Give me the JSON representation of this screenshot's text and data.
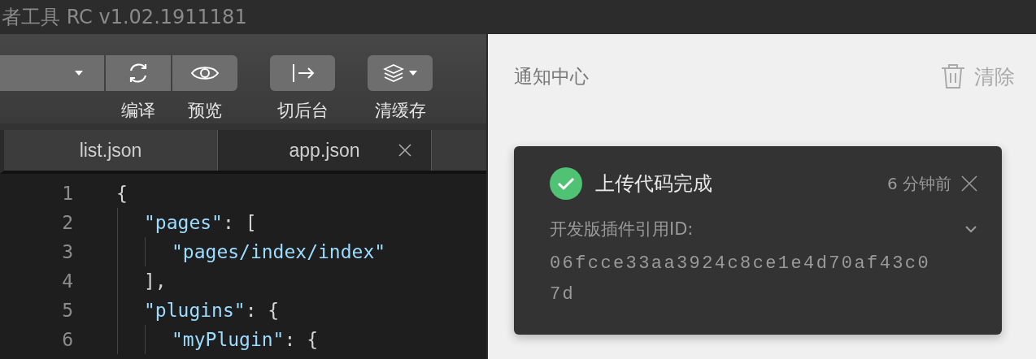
{
  "window": {
    "title": "者工具 RC v1.02.1911181"
  },
  "toolbar": {
    "buttons": [
      {
        "kind": "compile",
        "label": "编译"
      },
      {
        "kind": "preview",
        "label": "预览"
      },
      {
        "kind": "background",
        "label": "切后台"
      },
      {
        "kind": "cache",
        "label": "清缓存"
      }
    ]
  },
  "tabs": [
    {
      "label": "list.json",
      "selected": false
    },
    {
      "label": "app.json",
      "selected": true
    }
  ],
  "editor": {
    "lines": [
      {
        "number": "1",
        "tokens": [
          {
            "kind": "punct",
            "text": "{"
          }
        ],
        "children": [
          {
            "number": "2",
            "tokens": [
              {
                "kind": "string",
                "text": "\"pages\""
              },
              {
                "kind": "punct",
                "text": ": ["
              }
            ],
            "children": [
              {
                "number": "3",
                "tokens": [
                  {
                    "kind": "string",
                    "text": "\"pages/index/index\""
                  }
                ]
              }
            ]
          },
          {
            "number": "4",
            "tokens": [
              {
                "kind": "punct",
                "text": "],"
              }
            ]
          },
          {
            "number": "5",
            "tokens": [
              {
                "kind": "string",
                "text": "\"plugins\""
              },
              {
                "kind": "punct",
                "text": ": {"
              }
            ],
            "children": [
              {
                "number": "6",
                "tokens": [
                  {
                    "kind": "string",
                    "text": "\"myPlugin\""
                  },
                  {
                    "kind": "punct",
                    "text": ": {"
                  }
                ]
              }
            ]
          }
        ]
      }
    ]
  },
  "notifications": {
    "title": "通知中心",
    "clear_label": "清除",
    "items": [
      {
        "kind": "success",
        "title": "上传代码完成",
        "time": "6 分钟前",
        "label": "开发版插件引用ID:",
        "value": "06fcce33aa3924c8ce1e4d70af43c07d",
        "expanded": false
      }
    ]
  }
}
